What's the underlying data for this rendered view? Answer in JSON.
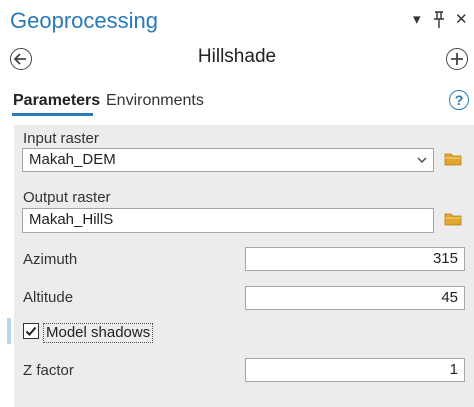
{
  "header": {
    "title": "Geoprocessing",
    "menu_glyph": "▾",
    "pin_glyph": "⫯",
    "close_glyph": "✕"
  },
  "tool": {
    "name": "Hillshade"
  },
  "tabs": [
    {
      "label": "Parameters",
      "active": true
    },
    {
      "label": "Environments",
      "active": false
    }
  ],
  "help_glyph": "?",
  "params": {
    "input_raster": {
      "label": "Input raster",
      "value": "Makah_DEM"
    },
    "output_raster": {
      "label": "Output raster",
      "value": "Makah_HillS"
    },
    "azimuth": {
      "label": "Azimuth",
      "value": "315"
    },
    "altitude": {
      "label": "Altitude",
      "value": "45"
    },
    "model_shadows": {
      "label": "Model shadows",
      "checked": true
    },
    "z_factor": {
      "label": "Z factor",
      "value": "1"
    }
  },
  "colors": {
    "accent": "#2a7ab9",
    "folder": "#e2a72f",
    "panel_bg": "#ececec"
  },
  "icons": {
    "back": "back-arrow-circle-icon",
    "add": "plus-circle-icon",
    "folder": "folder-icon",
    "dropdown": "chevron-down-icon",
    "check": "checkmark-icon",
    "help": "help-circle-icon"
  }
}
